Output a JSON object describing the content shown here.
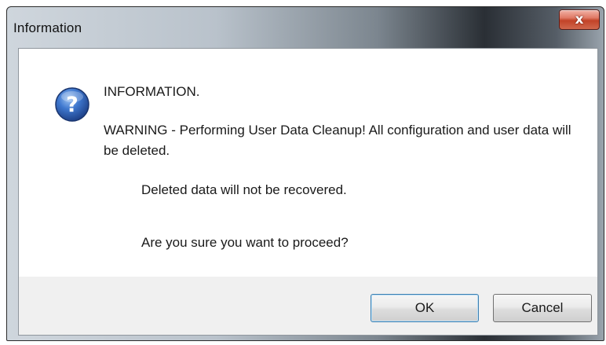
{
  "window": {
    "title": "Information",
    "close_symbol": "x"
  },
  "message": {
    "icon": "question-icon",
    "heading": "INFORMATION.",
    "warning": "WARNING - Performing User Data Cleanup! All configuration and user data will be deleted.",
    "detail": "Deleted data will not be recovered.",
    "question": "Are you sure you want to proceed?"
  },
  "buttons": {
    "ok_label": "OK",
    "cancel_label": "Cancel"
  },
  "colors": {
    "icon_blue": "#2f63b8",
    "close_red": "#c24328"
  }
}
